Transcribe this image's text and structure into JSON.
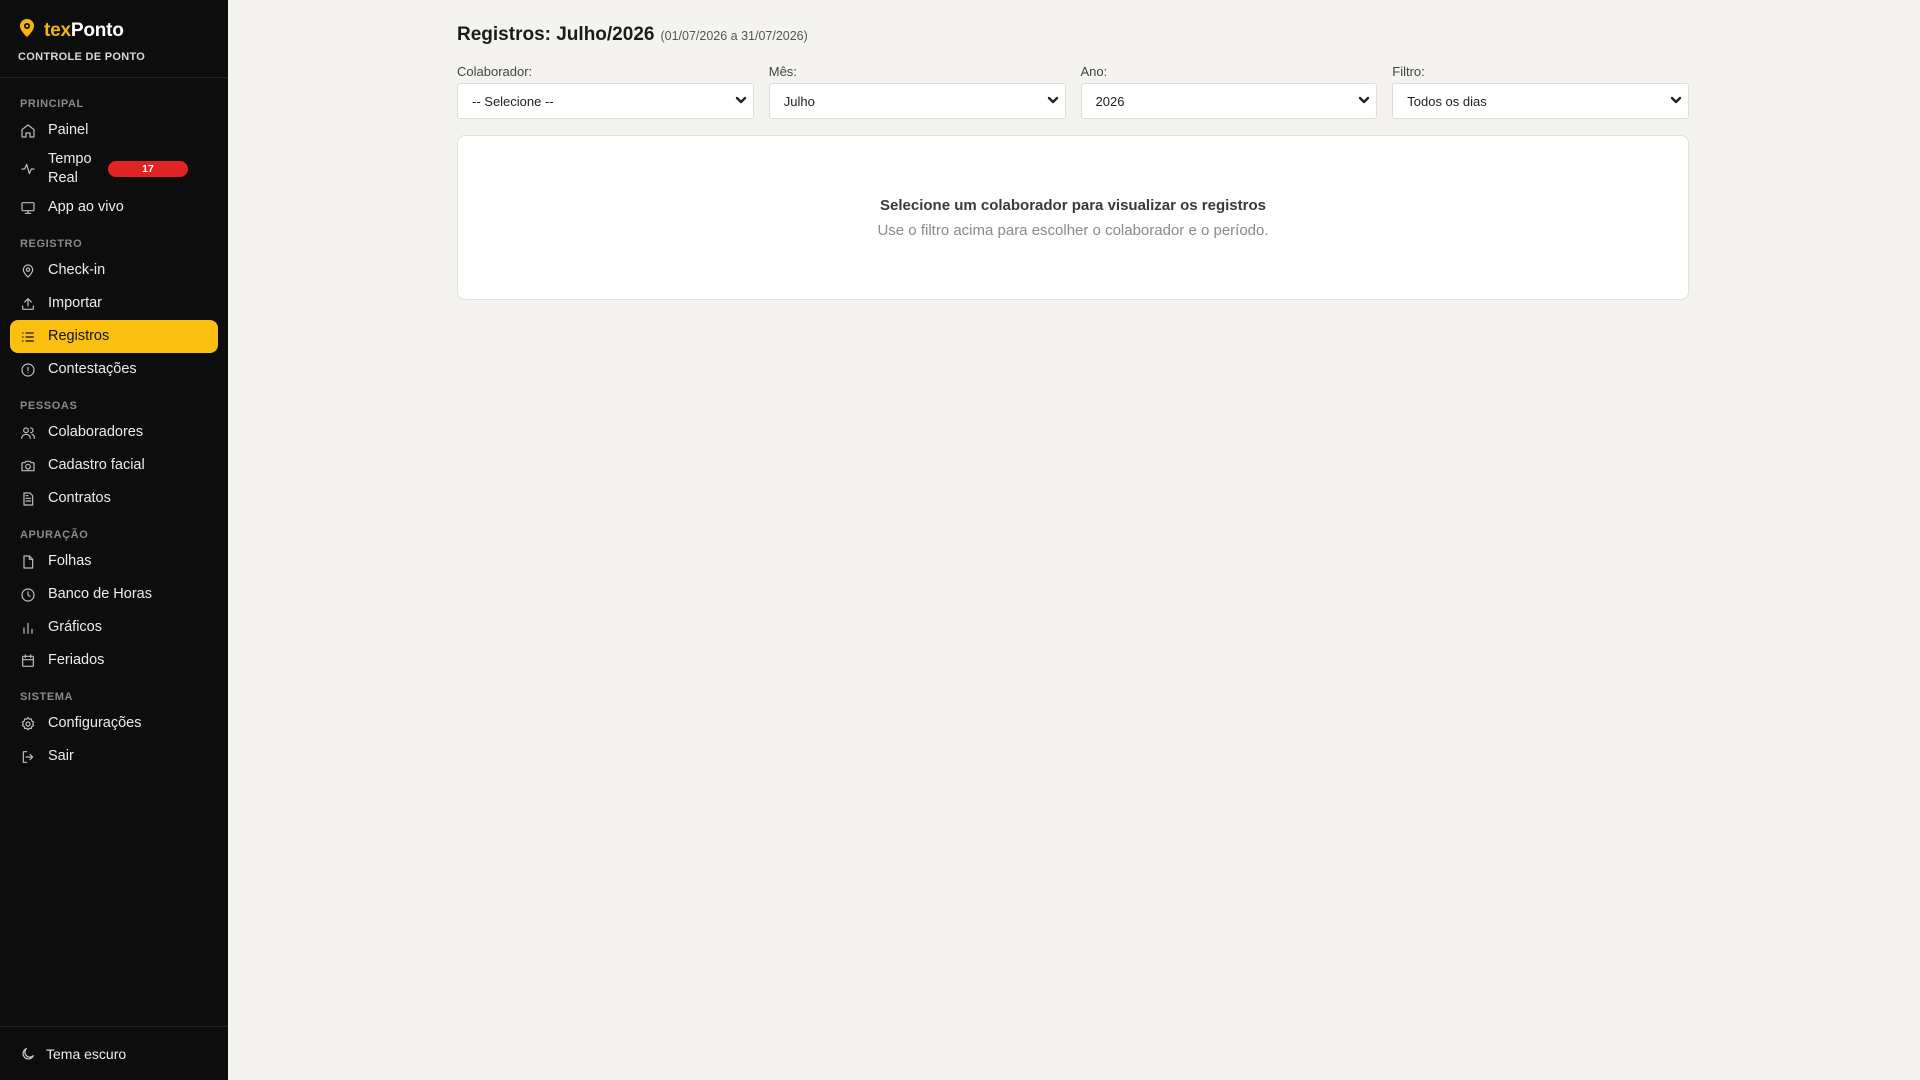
{
  "brand": {
    "name_part1": "tex",
    "name_part2": "Ponto",
    "subtitle": "CONTROLE DE PONTO",
    "accent": "#f6b40e"
  },
  "sidebar": {
    "sections": [
      {
        "title": "PRINCIPAL",
        "items": [
          {
            "label": "Painel",
            "icon": "home-icon"
          },
          {
            "label": "Tempo Real",
            "icon": "activity-icon",
            "badge": "17"
          },
          {
            "label": "App ao vivo",
            "icon": "monitor-icon"
          }
        ]
      },
      {
        "title": "REGISTRO",
        "items": [
          {
            "label": "Check-in",
            "icon": "map-pin-icon"
          },
          {
            "label": "Importar",
            "icon": "upload-icon"
          },
          {
            "label": "Registros",
            "icon": "list-icon",
            "active": true
          },
          {
            "label": "Contestações",
            "icon": "alert-circle-icon"
          }
        ]
      },
      {
        "title": "PESSOAS",
        "items": [
          {
            "label": "Colaboradores",
            "icon": "users-icon"
          },
          {
            "label": "Cadastro facial",
            "icon": "camera-icon"
          },
          {
            "label": "Contratos",
            "icon": "file-text-icon"
          }
        ]
      },
      {
        "title": "APURAÇÃO",
        "items": [
          {
            "label": "Folhas",
            "icon": "file-icon"
          },
          {
            "label": "Banco de Horas",
            "icon": "clock-icon"
          },
          {
            "label": "Gráficos",
            "icon": "bar-chart-icon"
          },
          {
            "label": "Feriados",
            "icon": "calendar-icon"
          }
        ]
      },
      {
        "title": "SISTEMA",
        "items": [
          {
            "label": "Configurações",
            "icon": "settings-icon"
          },
          {
            "label": "Sair",
            "icon": "logout-icon"
          }
        ]
      }
    ],
    "footer": {
      "label": "Tema escuro",
      "icon": "moon-icon"
    }
  },
  "page": {
    "title": "Registros: Julho/2026",
    "range": "(01/07/2026 a 31/07/2026)"
  },
  "filters": {
    "colaborador": {
      "label": "Colaborador:",
      "value": "-- Selecione --"
    },
    "mes": {
      "label": "Mês:",
      "value": "Julho"
    },
    "ano": {
      "label": "Ano:",
      "value": "2026"
    },
    "filtro": {
      "label": "Filtro:",
      "value": "Todos os dias"
    }
  },
  "empty_state": {
    "title": "Selecione um colaborador para visualizar os registros",
    "subtitle": "Use o filtro acima para escolher o colaborador e o período."
  },
  "colors": {
    "active_bg": "#fbbf10",
    "badge_bg": "#e02424",
    "sidebar_bg": "#0d0d0d",
    "page_bg": "#f4f3ef"
  }
}
